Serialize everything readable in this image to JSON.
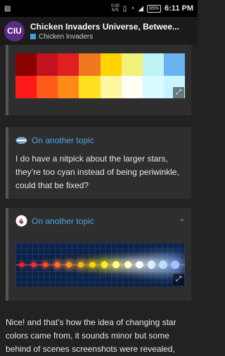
{
  "status_bar": {
    "speed": "0.00",
    "speed_unit": "K/S",
    "battery": "85%",
    "time": "6:11 PM"
  },
  "app_bar": {
    "logo_text": "CIU",
    "title": "Chicken Invaders Universe, Betwee...",
    "category": "Chicken Invaders",
    "category_color": "#3ea0e0"
  },
  "posts": [
    {
      "palette_colors": [
        "#8b0000",
        "#c1121f",
        "#e02020",
        "#f07820",
        "#ffd400",
        "#f2f27a",
        "#bff4f4",
        "#6ab3f0",
        "#ff1a1a",
        "#ff5a1a",
        "#ff8a1a",
        "#ffe020",
        "#fff7a0",
        "#fffef0",
        "#d8fbff",
        "#c8f4ff"
      ]
    },
    {
      "title": "On another topic",
      "body": "I do have a nitpick about the larger stars, they’re too cyan instead of being periwinkle, could that be fixed?"
    },
    {
      "title": "On another topic",
      "star_colors": [
        "#ff2020",
        "#ff3030",
        "#ff5020",
        "#ff7020",
        "#ff9020",
        "#ffb020",
        "#ffd000",
        "#fff020",
        "#ffff80",
        "#ffffc0",
        "#ffffff",
        "#e0f0ff",
        "#c0e0ff",
        "#a0c0ff"
      ]
    }
  ],
  "bottom_text": "Nice! and that’s how the idea of changing star colors came from, it sounds minor but some behind of scenes screenshots were revealed,"
}
